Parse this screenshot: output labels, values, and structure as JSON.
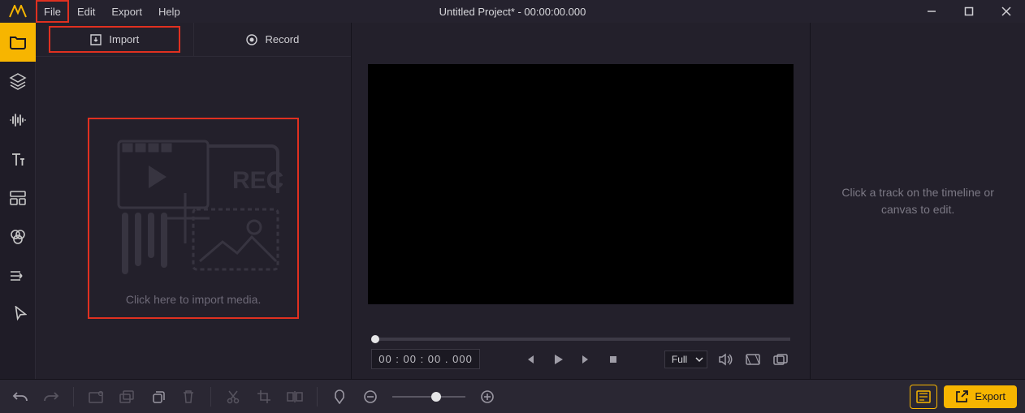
{
  "menubar": {
    "menus": {
      "file": "File",
      "edit": "Edit",
      "export": "Export",
      "help": "Help"
    },
    "title": "Untitled Project* - 00:00:00.000"
  },
  "media_panel": {
    "tabs": {
      "import": "Import",
      "record": "Record"
    },
    "dropzone_text": "Click here to import media.",
    "rec_label": "REC"
  },
  "preview": {
    "timecode": "00 : 00 : 00 . 000",
    "view_mode": "Full"
  },
  "inspector": {
    "message_line1": "Click a track on the timeline or",
    "message_line2": "canvas to edit."
  },
  "bottombar": {
    "export_label": "Export"
  }
}
